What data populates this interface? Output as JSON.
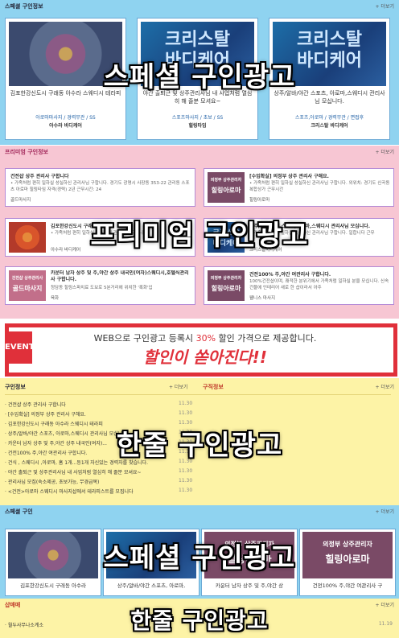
{
  "special": {
    "heading": "스페셜 구인정보",
    "more": "+ 더보기",
    "overlay": "스페셜 구인광고",
    "cards": [
      {
        "desc": "김포한강신도시 구래동 아수라 스웨디시 테라피",
        "sub": "아로마마사지 / 경력무관 / SS",
        "name": "아수라 바디케어"
      },
      {
        "img_text_1": "크리스탈",
        "img_text_2": "바디케어",
        "desc": "야간 출퇴근 및 상주관리사님 내 사업처럼 열심히 해 줄분 모셔요~",
        "sub": "스포츠마사지 / 초보 / SS",
        "name": "힐링타임"
      },
      {
        "img_text_1": "크리스탈",
        "img_text_2": "바디케어",
        "desc": "상주/알바/야간 스포츠, 아로마,스웨디시 관리사님 모십니다.",
        "sub": "스포츠,아로마 / 경력무관 / 면접후",
        "name": "크리스탈 바디케어"
      }
    ]
  },
  "premium": {
    "heading": "프리미엄 구인정보",
    "more": "+ 더보기",
    "overlay": "프리미엄 구인광고",
    "cards": [
      {
        "title": "건전샵 상주 관리사 구합니다",
        "desc": "• 가족처럼 편히 일하실 성실하신 관리사님 구합니다. 경기도 광명시 사장동 353-22 관리동 스포츠 아로마 힐링타임 자격(경력) 2년 근무시간: 24",
        "name": "골드마사지"
      },
      {
        "img": "의정부 상주관리자",
        "img2": "힐링아로마",
        "title": "[수입확실] 의정부 상주 관리사 구해요.",
        "desc": "• 가족처럼 편히 일하실 성실하신 관리사님 구합니다. 외위치: 경기도 신곡동 복합상가 근무시간",
        "name": "힐링아로마"
      },
      {
        "title": "김포한강신도시 구래동 아수라",
        "desc": "• 가족처럼 편히 일하실 성실하신 관리사님 구합니다.",
        "name": "아수라 바디케어"
      },
      {
        "img": "크리스탈",
        "img2": "바디케어",
        "title": "상주/알바/야간 스포츠,아로마,스웨디시 관리사님 모십니다.",
        "desc": "• 가족처럼 편히 일하실 성실하신 관리사님 구합니다. 일합니다 근무",
        "name": "크리스탈바디케어"
      },
      {
        "img": "건전샵 상주관리사",
        "img2": "골드마사지",
        "title": "카운터 남자 상주 및 주,야간 상주 내국인(여자)스웨디시,호텔식관리사 구합니다.",
        "desc": "청담동 힐링스파치료 도보로 5분거리에 위치한 '록화'입",
        "name": "육화"
      },
      {
        "img": "의정부 상주관리자",
        "img2": "힐링아로마",
        "title": "건전100% 주,야간 여관리사 구합니다.",
        "desc": "100%건전샵이며, 쾌적한 분위기에서 가족처럼 일하실 분을 모십니다. 신속건물에 인테리어 새로 한 샵이라서 아주",
        "name": "웰니스 마사지"
      }
    ]
  },
  "banner": {
    "tag": "EVENT",
    "text_prefix": "WEB으로 구인광고 등록시 ",
    "text_highlight": "30%",
    "text_suffix": " 할인 가격으로 제공합니다.",
    "slogan": "할인이 쏟아진다!!"
  },
  "oneline": {
    "heading": "구인정보",
    "more": "+ 더보기",
    "heading2": "구직정보",
    "more2": "+ 더보기",
    "overlay": "한줄 구인광고",
    "items": [
      {
        "text": "· 건전샵 상주 관리사 구합니다",
        "date": "11.30"
      },
      {
        "text": "· [수입확실] 의정부 상주 관리사 구해요.",
        "date": "11.30"
      },
      {
        "text": "· 김포한강신도시 구래동 아수라 스웨디시 테라피",
        "date": "11.30"
      },
      {
        "text": "· 상주/알바/야간 스포츠, 아로마,스웨디시 관리사님 모십니다.",
        "date": "11.30"
      },
      {
        "text": "· 카운터 남자 상주 및 주,야간 상주 내국인(여자)...",
        "date": "11.30"
      },
      {
        "text": "· 건전100% 주,야간 여관리사 구합니다.",
        "date": "11.30"
      },
      {
        "text": "· 건식 , 스웨디시 ,아로마, 홈 1개...등1개 자신있는 경력자를 찾습니다.",
        "date": "11.30"
      },
      {
        "text": "· 야간 출퇴근 및 상주관리사님 내 사업처럼 열심히 해 줄분 모셔요~",
        "date": "11.30"
      },
      {
        "text": "· 관리사님 모집(숙소제공, 초보가능, 무경급목)",
        "date": "11.30"
      },
      {
        "text": "· <건전>아로마 스웨디시 마사지샵에서 테라피스트를 모집니다",
        "date": "11.30"
      }
    ]
  },
  "special2": {
    "heading": "스페셜 구인",
    "more": "+ 더보기",
    "overlay": "스페셜 구인광고",
    "cards": [
      {
        "caption": "김포한강신도시 구래동 아수라"
      },
      {
        "caption": "상주/알바/야간 스포츠, 아로마,"
      },
      {
        "img": "의정부 상주관리자",
        "img2": "힐링아로마",
        "caption": "카운터 남자 상주 및 주,야간 상"
      },
      {
        "img": "의정부 상주관리자",
        "img2": "힐링아로마",
        "caption": "건전100% 주,야간 여관리사 구"
      }
    ]
  },
  "bottom": {
    "heading": "샵매매",
    "more": "+ 더보기",
    "overlay": "한줄 구인광고",
    "row": "· 월두사무나소계소",
    "date": "11.19"
  }
}
